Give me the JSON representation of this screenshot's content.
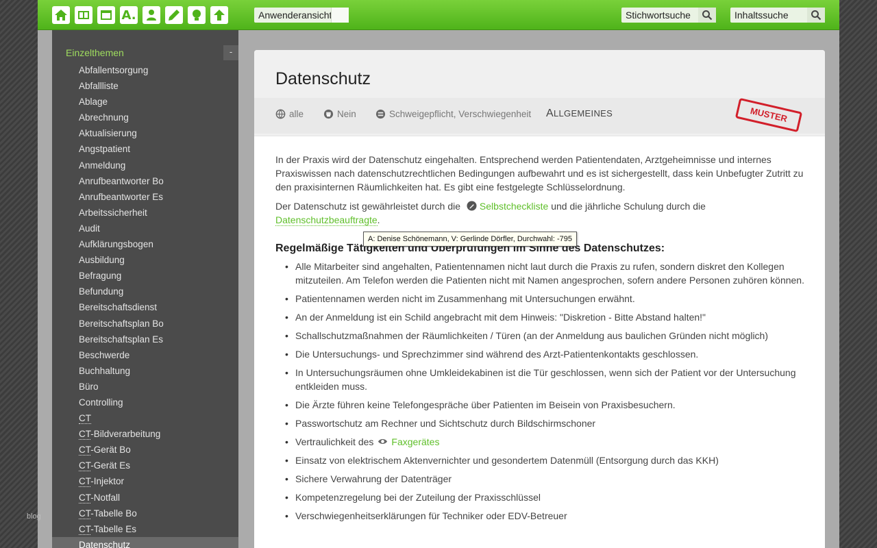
{
  "toolbar": {
    "icons": [
      "home-icon",
      "book-icon",
      "window-icon",
      "font-a-icon",
      "user-icon",
      "pencil-icon",
      "bulb-icon",
      "arrow-up-icon"
    ],
    "font_icon_label": "A.",
    "view_select": "Anwenderansicht",
    "keyword_search_placeholder": "Stichwortsuche",
    "content_search_placeholder": "Inhaltssuche",
    "accent_color": "#5cbf26"
  },
  "sidebar": {
    "heading": "Einzelthemen",
    "collapse_label": "-",
    "items": [
      "Abfallentsorgung",
      "Abfallliste",
      "Ablage",
      "Abrechnung",
      "Aktualisierung",
      "Angstpatient",
      "Anmeldung",
      "Anrufbeantworter Bo",
      "Anrufbeantworter Es",
      "Arbeitssicherheit",
      "Audit",
      "Aufklärungsbogen",
      "Ausbildung",
      "Befragung",
      "Befundung",
      "Bereitschaftsdienst",
      "Bereitschaftsplan Bo",
      "Bereitschaftsplan Es",
      "Beschwerde",
      "Buchhaltung",
      "Büro",
      "Controlling"
    ],
    "ct_items": [
      {
        "abbr": "CT",
        "rest": ""
      },
      {
        "abbr": "CT",
        "rest": "-Bildverarbeitung"
      },
      {
        "abbr": "CT",
        "rest": "-Gerät Bo"
      },
      {
        "abbr": "CT",
        "rest": "-Gerät Es"
      },
      {
        "abbr": "CT",
        "rest": "-Injektor"
      },
      {
        "abbr": "CT",
        "rest": "-Notfall"
      },
      {
        "abbr": "CT",
        "rest": "-Tabelle Bo"
      },
      {
        "abbr": "CT",
        "rest": "-Tabelle Es"
      }
    ],
    "active_item": "Datenschutz"
  },
  "article": {
    "title": "Datenschutz",
    "meta": {
      "audience": "alle",
      "flag": "Nein",
      "tags": "Schweigepflicht, Verschwiegenheit",
      "category_first": "A",
      "category_rest": "LLGEMEINES"
    },
    "stamp": "MUSTER",
    "intro": "In der Praxis wird der Datenschutz eingehalten. Entsprechend werden Patientendaten, Arztgeheimnisse und internes Praxiswissen nach datenschutzrechtlichen Bedingungen aufbewahrt und es ist sichergestellt, dass kein Unbefugter Zutritt zu den praxisinternen Räumlichkeiten hat. Es gibt eine festgelegte Schlüsselordnung.",
    "p2_before": "Der Datenschutz ist gewährleistet durch die",
    "p2_link1": "Selbstcheckliste",
    "p2_middle": "und die jährliche Schulung durch die",
    "p2_link2": "Datenschutzbeauftragte",
    "p2_end": ".",
    "tooltip": "A: Denise Schönemann, V: Gerlinde Dörfler, Durchwahl: -795",
    "heading": "Regelmäßige Tätigkeiten und Überprüfungen im Sinne des Datenschutzes:",
    "bullets": [
      "Alle Mitarbeiter sind angehalten, Patientennamen nicht laut durch die Praxis zu rufen, sondern diskret den Kollegen mitzuteilen. Am Telefon werden die Patienten nicht mit Namen angesprochen, sofern andere Personen zuhören können.",
      "Patientennamen werden nicht im Zusammenhang mit Untersuchungen erwähnt.",
      "An der Anmeldung ist ein Schild angebracht mit dem Hinweis: \"Diskretion - Bitte Abstand halten!\"",
      "Schallschutzmaßnahmen der Räumlichkeiten / Türen (an der Anmeldung aus baulichen Gründen nicht möglich)",
      "Die Untersuchungs- und Sprechzimmer sind während des Arzt-Patientenkontakts geschlossen.",
      "In Untersuchungsräumen ohne Umkleidekabinen ist die Tür geschlossen, wenn sich der Patient vor der Untersuchung entkleiden muss.",
      "Die Ärzte führen keine Telefongespräche über Patienten im Beisein von Praxisbesuchern.",
      "Passwortschutz am Rechner und Sichtschutz durch Bildschirmschoner"
    ],
    "bullet_fax_before": "Vertraulichkeit des",
    "bullet_fax_link": "Faxgerätes",
    "bullets_after": [
      "Einsatz von elektrischem Aktenvernichter und gesondertem Datenmüll (Entsorgung durch das KKH)",
      "Sichere Verwahrung der Datenträger",
      "Kompetenzregelung bei der Zuteilung der Praxisschlüssel",
      "Verschwiegenheitserklärungen für Techniker oder EDV-Betreuer"
    ]
  },
  "watermark": "blog"
}
